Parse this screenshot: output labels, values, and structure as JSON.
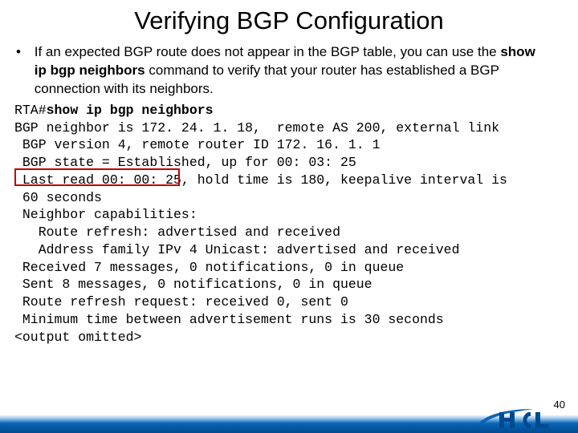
{
  "title": "Verifying BGP Configuration",
  "bullet": {
    "part1": "If an expected BGP route does not appear in the BGP table, you can use the ",
    "bold": "show ip bgp neighbors",
    "part2": " command to verify that your router has established a BGP connection with its neighbors."
  },
  "code": {
    "prompt": "RTA#",
    "cmd": "show ip bgp neighbors",
    "lines": [
      "BGP neighbor is 172. 24. 1. 18,  remote AS 200, external link",
      " BGP version 4, remote router ID 172. 16. 1. 1",
      " BGP state = Established, up for 00: 03: 25",
      " Last read 00: 00: 25, hold time is 180, keepalive interval is",
      " 60 seconds",
      " Neighbor capabilities:",
      "   Route refresh: advertised and received",
      "   Address family IPv 4 Unicast: advertised and received",
      " Received 7 messages, 0 notifications, 0 in queue",
      " Sent 8 messages, 0 notifications, 0 in queue",
      " Route refresh request: received 0, sent 0",
      " Minimum time between advertisement runs is 30 seconds",
      "<output omitted>"
    ]
  },
  "page": "40"
}
